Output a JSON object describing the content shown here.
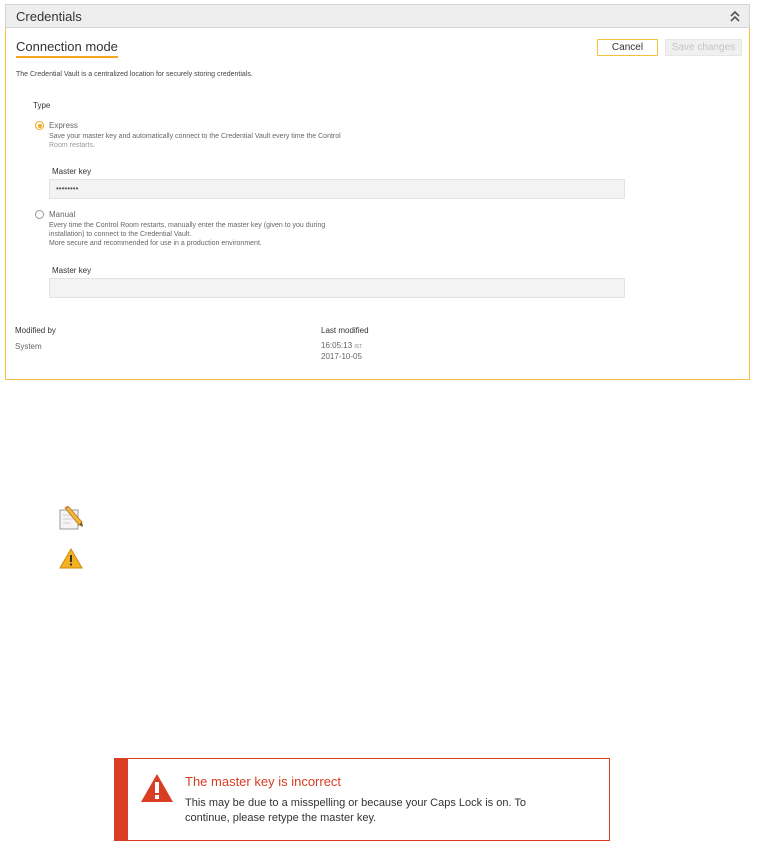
{
  "panel": {
    "title": "Credentials"
  },
  "section": {
    "title": "Connection mode",
    "cancel_label": "Cancel",
    "save_label": "Save changes",
    "description": "The Credential Vault is a centralized location for securely storing credentials."
  },
  "type": {
    "label": "Type",
    "options": [
      {
        "label": "Express",
        "selected": true,
        "desc_line1": "Save your master key and automatically connect to the Credential Vault every time the Control",
        "desc_line2": "Room restarts.",
        "field_label": "Master key",
        "field_value": "••••••••"
      },
      {
        "label": "Manual",
        "selected": false,
        "desc_line1": "Every time the Control Room restarts, manually enter the master key (given to you during",
        "desc_line2": "installation) to connect to the Credential Vault.",
        "desc_line3": "More secure and recommended for use in a production environment.",
        "field_label": "Master key",
        "field_value": ""
      }
    ]
  },
  "meta": {
    "modified_by_label": "Modified by",
    "modified_by_value": "System",
    "last_modified_label": "Last modified",
    "last_modified_time": "16:05:13",
    "last_modified_tz": "IST",
    "last_modified_date": "2017-10-05"
  },
  "icons": {
    "legend": [
      "pencil-icon",
      "warning-icon"
    ]
  },
  "error": {
    "title": "The master key is incorrect",
    "line1": "This may be due to a misspelling or because your Caps Lock is on. To",
    "line2": "continue, please retype the master key."
  },
  "colors": {
    "accent": "#f5a623",
    "panel_border": "#f5c23e",
    "error": "#d93d23"
  }
}
